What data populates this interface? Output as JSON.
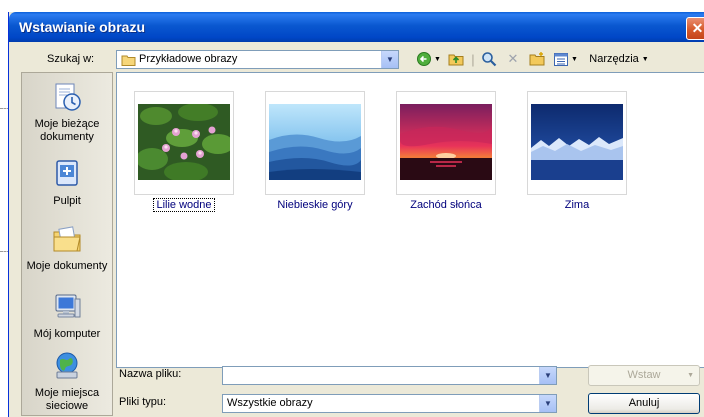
{
  "window": {
    "title": "Wstawianie obrazu",
    "close_label": "✕"
  },
  "lookin": {
    "label": "Szukaj w:",
    "value": "Przykładowe obrazy"
  },
  "toolbar": {
    "tools_label": "Narzędzia"
  },
  "places": [
    {
      "label": "Moje bieżące dokumenty",
      "icon": "recent-documents-icon"
    },
    {
      "label": "Pulpit",
      "icon": "desktop-icon"
    },
    {
      "label": "Moje dokumenty",
      "icon": "my-documents-folder-icon"
    },
    {
      "label": "Mój komputer",
      "icon": "my-computer-icon"
    },
    {
      "label": "Moje miejsca sieciowe",
      "icon": "network-places-icon"
    }
  ],
  "files": [
    {
      "name": "Lilie wodne"
    },
    {
      "name": "Niebieskie góry"
    },
    {
      "name": "Zachód słońca"
    },
    {
      "name": "Zima"
    }
  ],
  "filename": {
    "label": "Nazwa pliku:",
    "value": ""
  },
  "filetype": {
    "label": "Pliki typu:",
    "value": "Wszystkie obrazy"
  },
  "buttons": {
    "insert": "Wstaw",
    "cancel": "Anuluj"
  }
}
